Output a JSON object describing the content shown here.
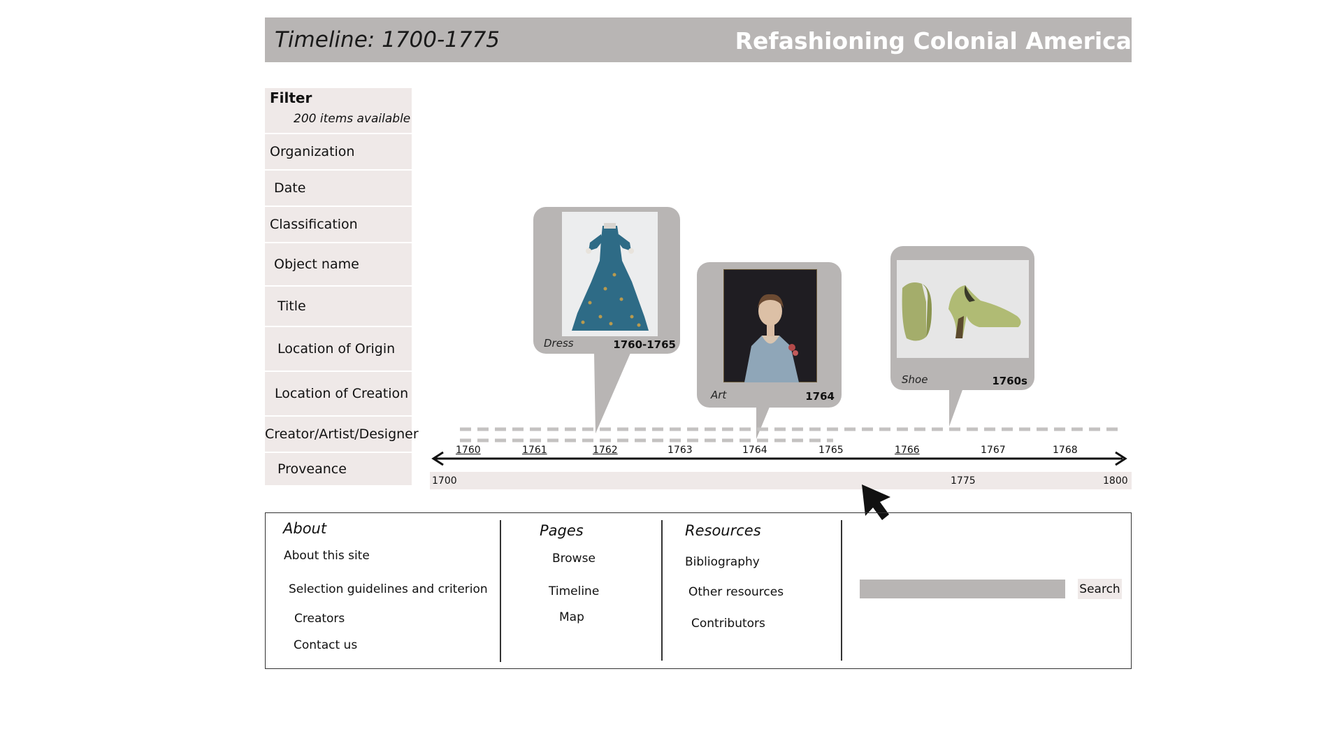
{
  "header": {
    "page_title": "Timeline: 1700-1775",
    "site_title": "Refashioning Colonial America"
  },
  "filter": {
    "title": "Filter",
    "count": "200 items available",
    "items": [
      "Organization",
      "Date",
      "Classification",
      "Object name",
      "Title",
      "Location of Origin",
      "Location of Creation",
      "Creator/Artist/Designer",
      "Proveance"
    ]
  },
  "timeline": {
    "items": [
      {
        "label": "Dress",
        "date": "1760-1765",
        "image": "blue silk gown"
      },
      {
        "label": "Art",
        "date": "1764",
        "image": "portrait of girl in blue dress"
      },
      {
        "label": "Shoe",
        "date": "1760s",
        "image": "pair of green brocade shoes"
      }
    ],
    "years": [
      "1760",
      "1761",
      "1762",
      "1763",
      "1764",
      "1765",
      "1766",
      "1767",
      "1768"
    ],
    "range_labels": [
      "1700",
      "1775",
      "1800"
    ]
  },
  "footer": {
    "about": {
      "title": "About",
      "links": [
        "About this site",
        "Selection guidelines and criterion",
        "Creators",
        "Contact us"
      ]
    },
    "pages": {
      "title": "Pages",
      "links": [
        "Browse",
        "Timeline",
        "Map"
      ]
    },
    "resources": {
      "title": "Resources",
      "links": [
        "Bibliography",
        "Other resources",
        "Contributors"
      ]
    },
    "search": {
      "button": "Search",
      "placeholder": ""
    }
  },
  "colors": {
    "header_bg": "#b8b5b4",
    "panel_bg": "#efe9e8",
    "card_bg": "#b8b5b4",
    "header_text": "#ffffff"
  }
}
